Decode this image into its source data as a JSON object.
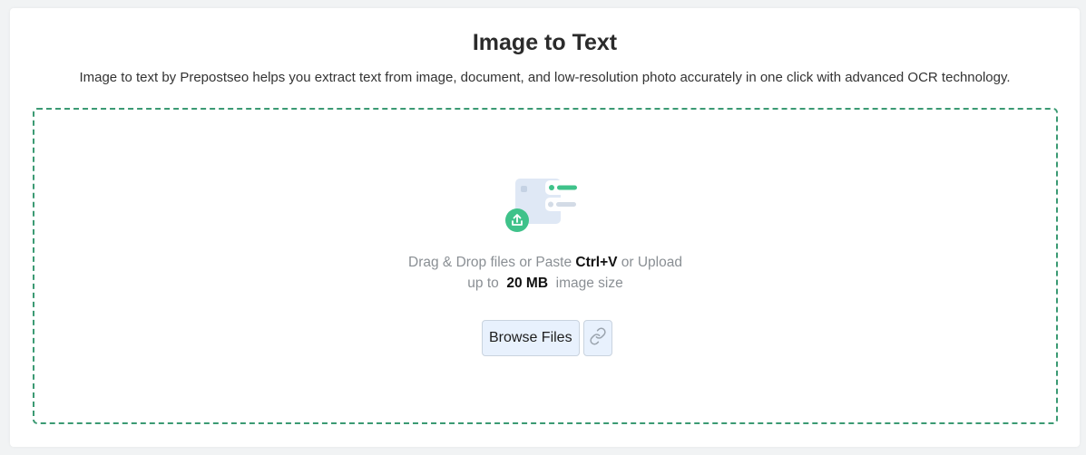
{
  "header": {
    "title": "Image to Text",
    "subtitle": "Image to text by Prepostseo helps you extract text from image, document, and low-resolution photo accurately in one click with advanced OCR technology."
  },
  "dropzone": {
    "line1_prefix": "Drag & Drop files or Paste ",
    "shortcut": "Ctrl+V",
    "line1_suffix": " or Upload",
    "line2_prefix": "up to ",
    "size_limit": "20 MB",
    "line2_suffix": " image size",
    "illustration_icon": "upload-image-icon",
    "browse_label": "Browse Files",
    "link_icon": "link-icon"
  },
  "colors": {
    "accent_green": "#3fc28a",
    "dashed_border": "#3b9a73",
    "button_bg": "#e8f1fd"
  }
}
